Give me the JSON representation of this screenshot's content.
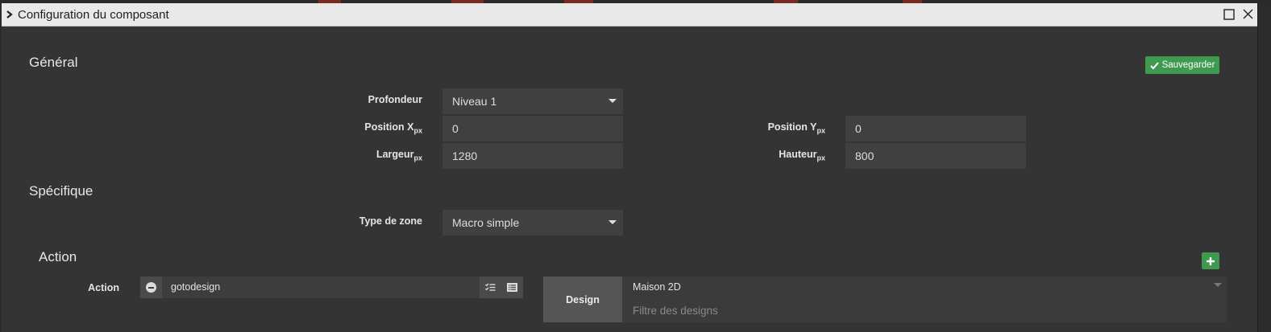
{
  "window": {
    "title": "Configuration du composant",
    "maximize_icon": "maximize-icon",
    "close_icon": "close-icon"
  },
  "general": {
    "title": "Général",
    "save_label": "Sauvegarder",
    "depth_label": "Profondeur",
    "depth_value": "Niveau 1",
    "pos_x_label": "Position X",
    "pos_y_label": "Position Y",
    "width_label": "Largeur",
    "height_label": "Hauteur",
    "unit": "px",
    "pos_x_value": "0",
    "pos_y_value": "0",
    "width_value": "1280",
    "height_value": "800"
  },
  "specific": {
    "title": "Spécifique",
    "zone_type_label": "Type de zone",
    "zone_type_value": "Macro simple"
  },
  "action": {
    "title": "Action",
    "row_label": "Action",
    "row_value": "gotodesign",
    "design_label": "Design",
    "design_value": "Maison 2D",
    "design_filter_placeholder": "Filtre des designs"
  },
  "colors": {
    "accent_green": "#3e9a4e",
    "titlebar": "#e9e9e9",
    "panel": "#343434",
    "field": "#404040"
  }
}
